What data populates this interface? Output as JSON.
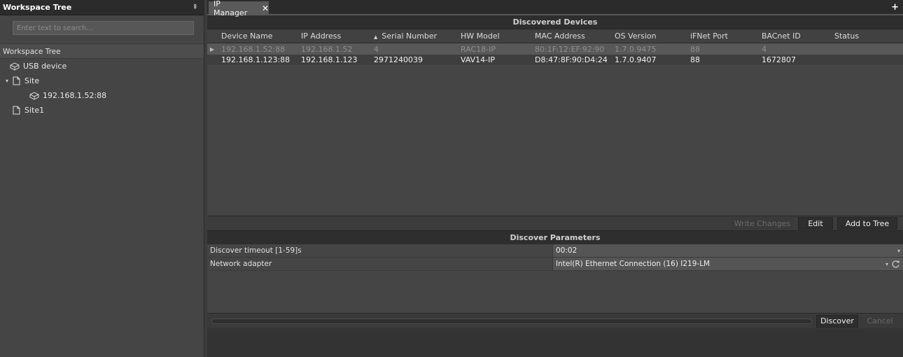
{
  "left_panel": {
    "title": "Workspace Tree",
    "pin": "⇞",
    "search_placeholder": "Enter text to search...",
    "tree_root": "Workspace Tree",
    "items": [
      {
        "label": "USB device"
      },
      {
        "label": "Site"
      },
      {
        "label": "192.168.1.52:88"
      },
      {
        "label": "Site1"
      }
    ]
  },
  "tab": {
    "label": "IP Manager",
    "close": "✕"
  },
  "tabbar": {
    "add": "+"
  },
  "devices": {
    "title": "Discovered Devices",
    "columns": [
      "Device Name",
      "IP Address",
      "Serial Number",
      "HW Model",
      "MAC Address",
      "OS Version",
      "iFNet Port",
      "BACnet ID",
      "Status"
    ],
    "sort_indicator": "▲",
    "rows": [
      [
        "192.168.1.52:88",
        "192.168.1.52",
        "4",
        "RAC18-IP",
        "80:1F:12:EF:92:90",
        "1.7.0.9475",
        "88",
        "4",
        ""
      ],
      [
        "192.168.1.123:88",
        "192.168.1.123",
        "2971240039",
        "VAV14-IP",
        "D8:47:8F:90:D4:24",
        "1.7.0.9407",
        "88",
        "1672807",
        ""
      ]
    ],
    "row_marker": "▶"
  },
  "actions": {
    "write_changes": "Write Changes",
    "edit": "Edit",
    "add_to_tree": "Add to Tree"
  },
  "params": {
    "title": "Discover Parameters",
    "timeout_label": "Discover timeout [1-59]s",
    "timeout_value": "00:02",
    "adapter_label": "Network adapter",
    "adapter_value": "Intel(R) Ethernet Connection (16) I219-LM",
    "dropdown_glyph": "▾"
  },
  "bottom": {
    "progress": 0,
    "discover": "Discover",
    "cancel": "Cancel"
  },
  "colors": {
    "accent": "#ffffff",
    "panel_bg": "#454545",
    "header_bg": "#2b2b2b"
  }
}
